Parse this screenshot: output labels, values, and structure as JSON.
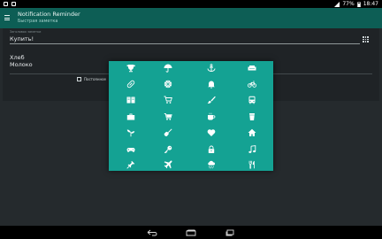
{
  "status_bar": {
    "battery_percent": "77%",
    "time": "18:47"
  },
  "action_bar": {
    "title": "Notification Reminder",
    "subtitle": "Быстрая заметка"
  },
  "form": {
    "title_caption": "Заголовок заметки",
    "title_value": "Купить!",
    "note_text": "Хлеб\nМолоко",
    "persistent_label": "Постоянное"
  },
  "icon_dialog": {
    "icons": [
      [
        "trophy-icon",
        "umbrella-icon",
        "anchor-icon",
        "sofa-icon"
      ],
      [
        "pill-icon",
        "ball-icon",
        "bell-icon",
        "bicycle-icon"
      ],
      [
        "book-icon",
        "shopping-cart-icon",
        "brush-icon",
        "bus-icon"
      ],
      [
        "briefcase-icon",
        "cart-icon",
        "coffee-icon",
        "cup-icon"
      ],
      [
        "plant-icon",
        "guitar-icon",
        "heart-icon",
        "home-icon"
      ],
      [
        "gamepad-icon",
        "key-icon",
        "lock-icon",
        "music-note-icon"
      ],
      [
        "pin-icon",
        "airplane-icon",
        "rain-cloud-icon",
        "cutlery-icon"
      ]
    ],
    "colors": {
      "background": "#14a293",
      "icon": "#ffffff"
    }
  },
  "nav_bar": {
    "buttons": [
      "back-icon",
      "home-icon",
      "recents-icon"
    ]
  }
}
